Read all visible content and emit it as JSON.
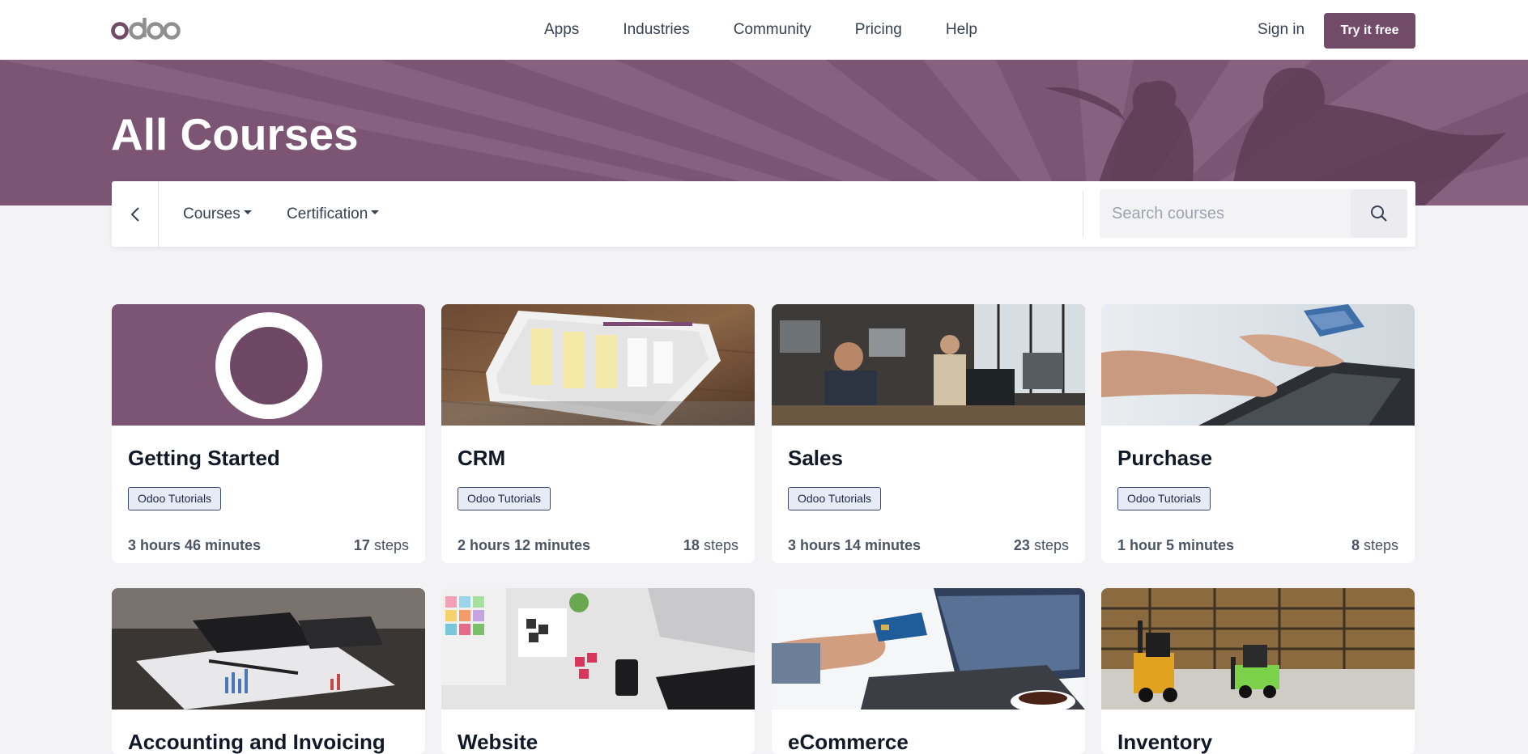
{
  "header": {
    "logo_text": "odoo",
    "nav": [
      "Apps",
      "Industries",
      "Community",
      "Pricing",
      "Help"
    ],
    "signin": "Sign in",
    "cta": "Try it free"
  },
  "hero": {
    "title": "All Courses"
  },
  "filters": {
    "courses_label": "Courses",
    "certification_label": "Certification",
    "search_placeholder": "Search courses"
  },
  "colors": {
    "brand": "#714b67",
    "hero": "#7b5573",
    "tag_bg": "#e6ebf5"
  },
  "courses": [
    {
      "title": "Getting Started",
      "tag": "Odoo Tutorials",
      "duration": "3 hours 46 minutes",
      "steps_n": "17",
      "steps_word": "steps",
      "image": "odoo-ring-illustration"
    },
    {
      "title": "CRM",
      "tag": "Odoo Tutorials",
      "duration": "2 hours 12 minutes",
      "steps_n": "18",
      "steps_word": "steps",
      "image": "tablet-kanban-photo"
    },
    {
      "title": "Sales",
      "tag": "Odoo Tutorials",
      "duration": "3 hours 14 minutes",
      "steps_n": "23",
      "steps_word": "steps",
      "image": "office-people-photo"
    },
    {
      "title": "Purchase",
      "tag": "Odoo Tutorials",
      "duration": "1 hour 5 minutes",
      "steps_n": "8",
      "steps_word": "steps",
      "image": "card-laptop-photo"
    },
    {
      "title": "Accounting and Invoicing",
      "image": "documents-pen-photo"
    },
    {
      "title": "Website",
      "image": "design-desk-photo"
    },
    {
      "title": "eCommerce",
      "image": "online-payment-photo"
    },
    {
      "title": "Inventory",
      "image": "warehouse-forklift-photo"
    }
  ]
}
